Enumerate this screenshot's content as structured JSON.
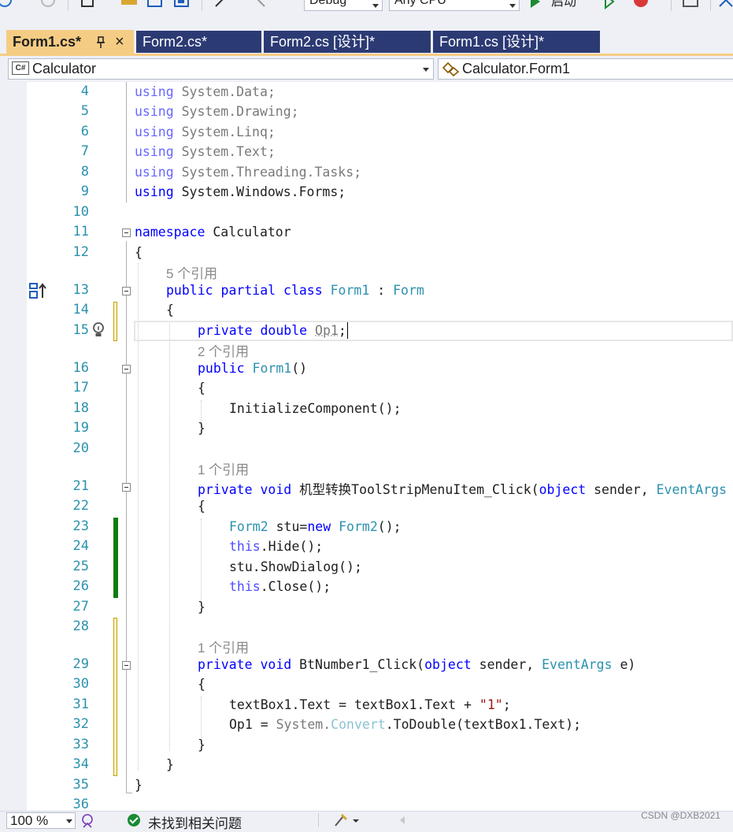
{
  "toolbar": {
    "config_value": "Debug",
    "platform_value": "Any CPU",
    "start_label": "启动"
  },
  "tabs": [
    {
      "label": "Form1.cs*",
      "active": true
    },
    {
      "label": "Form2.cs*",
      "active": false
    },
    {
      "label": "Form2.cs [设计]*",
      "active": false
    },
    {
      "label": "Form1.cs [设计]*",
      "active": false
    }
  ],
  "tab_pin_glyph": "ᵖ",
  "tab_close_glyph": "×",
  "nav": {
    "project_badge": "C#",
    "project": "Calculator",
    "class": "Calculator.Form1"
  },
  "line_numbers": [
    "4",
    "5",
    "6",
    "7",
    "8",
    "9",
    "10",
    "11",
    "12",
    "13",
    "14",
    "15",
    "16",
    "17",
    "18",
    "19",
    "20",
    "21",
    "22",
    "23",
    "24",
    "25",
    "26",
    "27",
    "28",
    "29",
    "30",
    "31",
    "32",
    "33",
    "34",
    "35",
    "36"
  ],
  "references": {
    "class_refs": "5 个引用",
    "ctor_refs": "2 个引用",
    "menu_refs": "1 个引用",
    "btn_refs": "1 个引用"
  },
  "code": {
    "l4_kw": "using",
    "l4_ns": " System.Data;",
    "l5_kw": "using",
    "l5_ns": " System.Drawing;",
    "l6_kw": "using",
    "l6_ns": " System.Linq;",
    "l7_kw": "using",
    "l7_ns": " System.Text;",
    "l8_kw": "using",
    "l8_ns": " System.Threading.Tasks;",
    "l9_kw": "using",
    "l9_ns": " System.Windows.Forms;",
    "l11_kw": "namespace",
    "l11_name": " Calculator",
    "l12": "{",
    "l13_kw": "public partial class",
    "l13_name": "Form1",
    "l13_colon": " : ",
    "l13_base": "Form",
    "l14": "{",
    "l15_kw": "private double",
    "l15_field": "Op1",
    "l15_semi": ";",
    "l16_kw": "public",
    "l16_name": "Form1",
    "l16_rest": "()",
    "l17": "{",
    "l18": "InitializeComponent();",
    "l19": "}",
    "l21_kw": "private void",
    "l21_name": " 机型转换ToolStripMenuItem_Click(",
    "l21_obj": "object",
    "l21_rest": " sender, ",
    "l21_type": "EventArgs e)",
    "l22": "{",
    "l23_type1": "Form2",
    "l23_mid": " stu=",
    "l23_new": "new",
    "l23_type2": " Form2",
    "l23_rest": "();",
    "l24_this": "this",
    "l24_rest": ".Hide();",
    "l25": "stu.ShowDialog();",
    "l26_this": "this",
    "l26_rest": ".Close();",
    "l27": "}",
    "l29_kw": "private void",
    "l29_name": " BtNumber1_Click(",
    "l29_obj": "object",
    "l29_rest": " sender, ",
    "l29_type": "EventArgs",
    "l29_end": " e)",
    "l30": "{",
    "l31_pre": "textBox1.Text = textBox1.Text + ",
    "l31_str": "\"1\"",
    "l31_end": ";",
    "l32_pre": "Op1 = ",
    "l32_sys": "System.",
    "l32_conv": "Convert",
    "l32_rest": ".ToDouble(textBox1.Text);",
    "l33": "}",
    "l34": "}",
    "l35": "}"
  },
  "status": {
    "zoom": "100 %",
    "issues": "未找到相关问题"
  },
  "watermark": "CSDN @DXB2021",
  "colors": {
    "keyword": "#0000ff",
    "type": "#2b91af",
    "string": "#a31515",
    "active_tab": "#f5cc84",
    "inactive_tab": "#2c3a74",
    "change_saved": "#107c10",
    "change_unsaved": "#c4a000"
  }
}
